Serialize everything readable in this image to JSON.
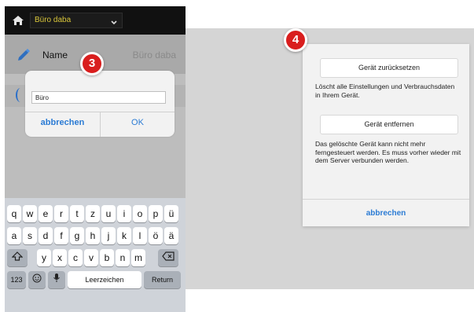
{
  "phone": {
    "location": "Büro daba",
    "name_label": "Name",
    "name_value": "Büro daba",
    "badge": "3",
    "rename_dialog": {
      "input_value": "Büro",
      "cancel": "abbrechen",
      "ok": "OK"
    },
    "keyboard": {
      "row1": [
        "q",
        "w",
        "e",
        "r",
        "t",
        "z",
        "u",
        "i",
        "o",
        "p",
        "ü"
      ],
      "row2": [
        "a",
        "s",
        "d",
        "f",
        "g",
        "h",
        "j",
        "k",
        "l",
        "ö",
        "ä"
      ],
      "row3": [
        "y",
        "x",
        "c",
        "v",
        "b",
        "n",
        "m"
      ],
      "numbers": "123",
      "space": "Leerzeichen",
      "return": "Return"
    }
  },
  "device_dialog": {
    "badge": "4",
    "reset_button": "Gerät zurücksetzen",
    "reset_description": "Löscht alle Einstellungen und Verbrauchsdaten in Ihrem Gerät.",
    "remove_button": "Gerät entfernen",
    "remove_description": "Das gelöschte Gerät kann nicht mehr ferngesteuert werden. Es muss vorher wieder mit dem Server verbunden werden.",
    "cancel": "abbrechen"
  },
  "colors": {
    "accent_blue": "#2b7bd4",
    "badge_red": "#d91e1e",
    "location_yellow": "#d9c63a"
  }
}
